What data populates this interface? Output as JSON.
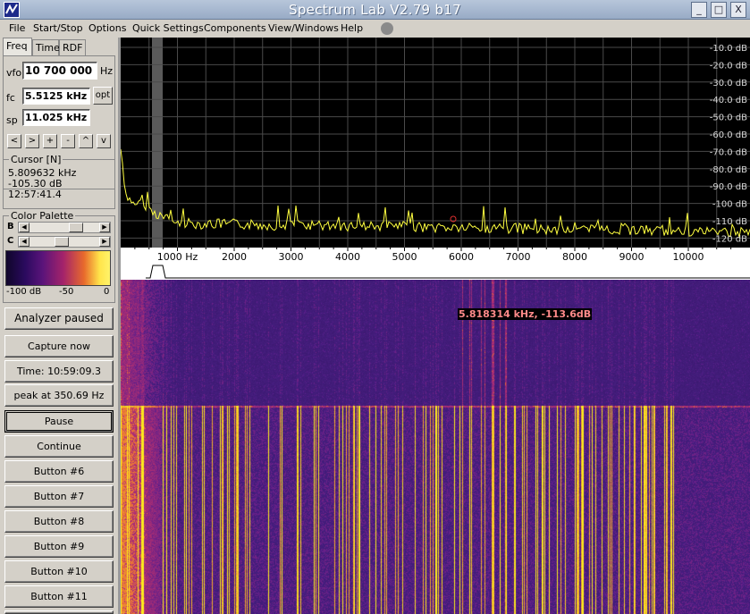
{
  "window": {
    "title": "Spectrum Lab V2.79 b17",
    "controls": [
      "_",
      "□",
      "X"
    ]
  },
  "menu": [
    "File",
    "Start/Stop",
    "Options",
    "Quick Settings",
    "Components",
    "View/Windows",
    "Help"
  ],
  "tabs": [
    "Freq",
    "Time",
    "RDF"
  ],
  "freq_panel": {
    "vfo_label": "vfo",
    "vfo_value": "10 700 000",
    "vfo_unit": "Hz",
    "fc_label": "fc",
    "fc_value": "5.5125 kHz",
    "opt_label": "opt",
    "sp_label": "sp",
    "sp_value": "11.025 kHz",
    "nav_buttons": [
      "<",
      ">",
      "+",
      "-",
      "^",
      "v"
    ]
  },
  "cursor": {
    "title": "Cursor [N]",
    "freq": "5.809632 kHz",
    "level": "-105.30 dB",
    "time": "12:57:41.4"
  },
  "color_palette": {
    "title": "Color Palette",
    "b_label": "B",
    "c_label": "C",
    "scale": [
      "-100 dB",
      "-50",
      "0"
    ]
  },
  "buttons": {
    "analyzer": "Analyzer paused",
    "capture": "Capture now",
    "time": "Time:  10:59:09.3",
    "peak": "peak at 350.69 Hz",
    "pause": "Pause",
    "continue": "Continue",
    "b6": "Button #6",
    "b7": "Button #7",
    "b8": "Button #8",
    "b9": "Button #9",
    "b10": "Button #10",
    "b11": "Button #11"
  },
  "spectrum": {
    "db_labels": [
      "-10.0 dB",
      "-20.0 dB",
      "-30.0 dB",
      "-40.0 dB",
      "-50.0 dB",
      "-60.0 dB",
      "-70.0 dB",
      "-80.0 dB",
      "-90.0 dB",
      "-100 dB",
      "-110 dB",
      "-120 dB"
    ],
    "freq_labels": [
      "1000 Hz",
      "2000",
      "3000",
      "4000",
      "5000",
      "6000",
      "7000",
      "8000",
      "9000",
      "10000"
    ],
    "marker_readout": "5.818314 kHz, -113.6dB",
    "colors": {
      "trace": "#ffff40",
      "grid": "#4a4a4a",
      "background": "#000000"
    }
  }
}
